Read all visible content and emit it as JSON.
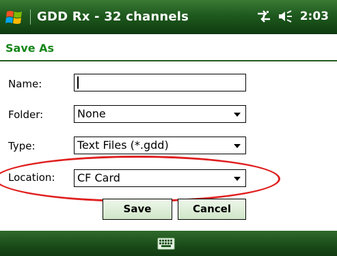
{
  "titlebar": {
    "title": "GDD Rx - 32 channels",
    "time": "2:03",
    "icons": [
      "windows-start-icon",
      "connectivity-icon",
      "volume-icon"
    ]
  },
  "form": {
    "header": "Save As",
    "name_label": "Name:",
    "name_value": "",
    "folder_label": "Folder:",
    "folder_value": "None",
    "type_label": "Type:",
    "type_value": "Text Files (*.gdd)",
    "location_label": "Location:",
    "location_value": "CF Card"
  },
  "buttons": {
    "save": "Save",
    "cancel": "Cancel"
  },
  "bottombar": {
    "icon": "keyboard-icon"
  },
  "colors": {
    "titlebar_green": "#1f5a1e",
    "header_text_green": "#17861a",
    "button_fill": "#cfe6c8",
    "highlight_red": "#e01f1f"
  }
}
